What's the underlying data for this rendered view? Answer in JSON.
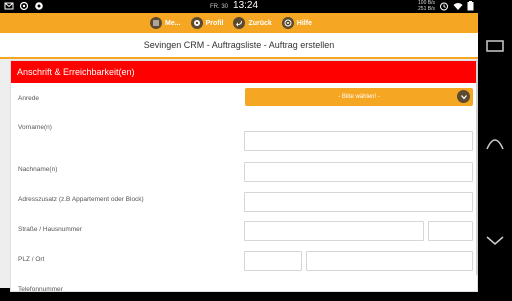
{
  "status_bar": {
    "date": "FR. 30",
    "time": "13:24",
    "net_up": "100 B/s",
    "net_down": "251 B/s"
  },
  "nav": {
    "menu_label": "Me...",
    "profile_label": "Profil",
    "back_label": "Zurück",
    "help_label": "Hilfe"
  },
  "title": "Sevingen CRM - Auftragsliste - Auftrag erstellen",
  "section": {
    "heading": "Anschrift & Erreichbarkeit(en)",
    "fields": {
      "anrede_label": "Anrede",
      "anrede_value": "- Bitte wählen! -",
      "vorname_label": "Vorname(n)",
      "nachname_label": "Nachname(n)",
      "adresszusatz_label": "Adresszusatz (z.B Appartement oder Block)",
      "strasse_label": "Straße / Hausnummer",
      "plz_label": "PLZ / Ort",
      "telefon_label": "Telefonnummer"
    }
  },
  "colors": {
    "accent": "#f5a623",
    "section_header": "#ff0000",
    "icon_dark": "#5b4a2f"
  }
}
